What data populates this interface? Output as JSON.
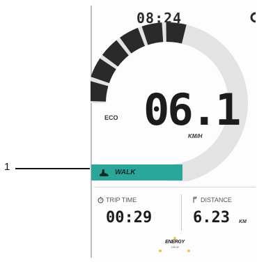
{
  "callout": {
    "number": "1"
  },
  "header": {
    "clock": "08:24",
    "status_icon": "status-glyph-icon"
  },
  "speed": {
    "value": "06.1",
    "unit": "KM/H",
    "assist_mode_label": "ECO",
    "gauge_level": 0.39,
    "gauge_color": "#2a2a2a",
    "track_color": "#e3e3e3"
  },
  "walk": {
    "label": "WALK",
    "icon": "walk-shoe-icon",
    "color": "#2aa79a"
  },
  "stats": {
    "trip_time": {
      "label": "TRIP TIME",
      "value": "00:29",
      "icon": "stopwatch-icon"
    },
    "distance": {
      "label": "DISTANCE",
      "value": "6.23",
      "unit": "KM",
      "icon": "distance-icon"
    }
  },
  "brand": {
    "name": "ENERGY",
    "sub": "125 W",
    "accent_color": "#f2c14e"
  }
}
